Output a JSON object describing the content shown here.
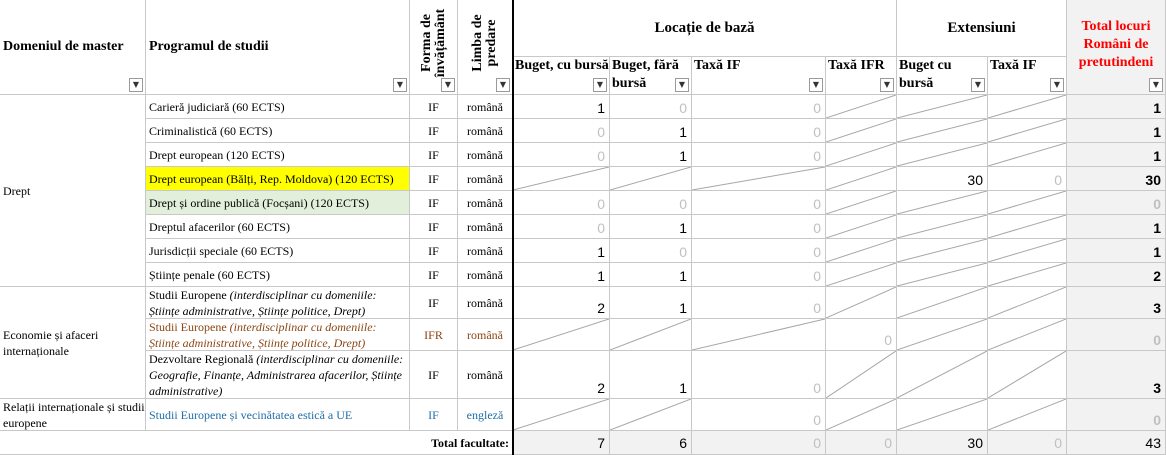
{
  "headers": {
    "domain": "Domeniul de master",
    "program": "Programul de studii",
    "form": "Forma de învățământ",
    "lang": "Limba de predare",
    "base_location": "Locație de bază",
    "extensions": "Extensiuni",
    "total_title": "Total locuri Români de pretutindeni",
    "buget_bursa": "Buget, cu bursă",
    "buget_fara": "Buget, fără bursă",
    "taxa_if": "Taxă IF",
    "taxa_ifr": "Taxă IFR",
    "ext_buget": "Buget cu bursă",
    "ext_taxa": "Taxă IF"
  },
  "filter_icon": "dropdown-arrow",
  "colors": {
    "highlight_yellow": "#ffff00",
    "highlight_green": "#e2efda",
    "total_red": "#ff0000",
    "ifr_brown": "#8b4513",
    "link_blue": "#1f6fa8"
  },
  "domains": [
    "Drept",
    "Economie și afaceri internaționale",
    "Relații internaționale și studii europene"
  ],
  "rows": [
    {
      "program": "Carieră judiciară (60 ECTS)",
      "form": "IF",
      "lang": "română",
      "bb": "1",
      "bf": "0",
      "tif": "0",
      "tifr": "",
      "eb": "",
      "et": "",
      "tot": "1"
    },
    {
      "program": "Criminalistică (60 ECTS)",
      "form": "IF",
      "lang": "română",
      "bb": "0",
      "bf": "1",
      "tif": "0",
      "tifr": "",
      "eb": "",
      "et": "",
      "tot": "1"
    },
    {
      "program": "Drept european (120 ECTS)",
      "form": "IF",
      "lang": "română",
      "bb": "0",
      "bf": "1",
      "tif": "0",
      "tifr": "",
      "eb": "",
      "et": "",
      "tot": "1"
    },
    {
      "program": "Drept european (Bălți, Rep. Moldova) (120 ECTS)",
      "form": "IF",
      "lang": "română",
      "bb": "",
      "bf": "",
      "tif": "",
      "tifr": "",
      "eb": "30",
      "et": "0",
      "tot": "30"
    },
    {
      "program": "Drept și ordine publică (Focșani) (120 ECTS)",
      "form": "IF",
      "lang": "română",
      "bb": "0",
      "bf": "0",
      "tif": "0",
      "tifr": "",
      "eb": "",
      "et": "",
      "tot": "0"
    },
    {
      "program": "Dreptul afacerilor (60 ECTS)",
      "form": "IF",
      "lang": "română",
      "bb": "0",
      "bf": "1",
      "tif": "0",
      "tifr": "",
      "eb": "",
      "et": "",
      "tot": "1"
    },
    {
      "program": "Jurisdicții speciale (60 ECTS)",
      "form": "IF",
      "lang": "română",
      "bb": "1",
      "bf": "0",
      "tif": "0",
      "tifr": "",
      "eb": "",
      "et": "",
      "tot": "1"
    },
    {
      "program": "Științe penale (60 ECTS)",
      "form": "IF",
      "lang": "română",
      "bb": "1",
      "bf": "1",
      "tif": "0",
      "tifr": "",
      "eb": "",
      "et": "",
      "tot": "2"
    },
    {
      "program_main": "Studii Europene ",
      "program_ital": "(interdisciplinar cu domeniile: Științe administrative, Științe politice, Drept)",
      "form": "IF",
      "lang": "română",
      "bb": "2",
      "bf": "1",
      "tif": "0",
      "tifr": "",
      "eb": "",
      "et": "",
      "tot": "3"
    },
    {
      "program_main": "Studii Europene ",
      "program_ital": "(interdisciplinar cu domeniile: Științe administrative, Științe politice, Drept)",
      "form": "IFR",
      "lang": "română",
      "bb": "",
      "bf": "",
      "tif": "",
      "tifr": "0",
      "eb": "",
      "et": "",
      "tot": "0"
    },
    {
      "program_main": "Dezvoltare Regională ",
      "program_ital": "(interdisciplinar cu domeniile: Geografie, Finanțe, Administrarea afacerilor, Științe administrative)",
      "form": "IF",
      "lang": "română",
      "bb": "2",
      "bf": "1",
      "tif": "0",
      "tifr": "",
      "eb": "",
      "et": "",
      "tot": "3"
    },
    {
      "program": "Studii Europene și vecinătatea estică a UE",
      "form": "IF",
      "lang": "engleză",
      "bb": "",
      "bf": "",
      "tif": "0",
      "tifr": "",
      "eb": "",
      "et": "",
      "tot": "0"
    }
  ],
  "totals": {
    "label": "Total facultate:",
    "bb": "7",
    "bf": "6",
    "tif": "0",
    "tifr": "0",
    "eb": "30",
    "et": "0",
    "tot": "43"
  }
}
